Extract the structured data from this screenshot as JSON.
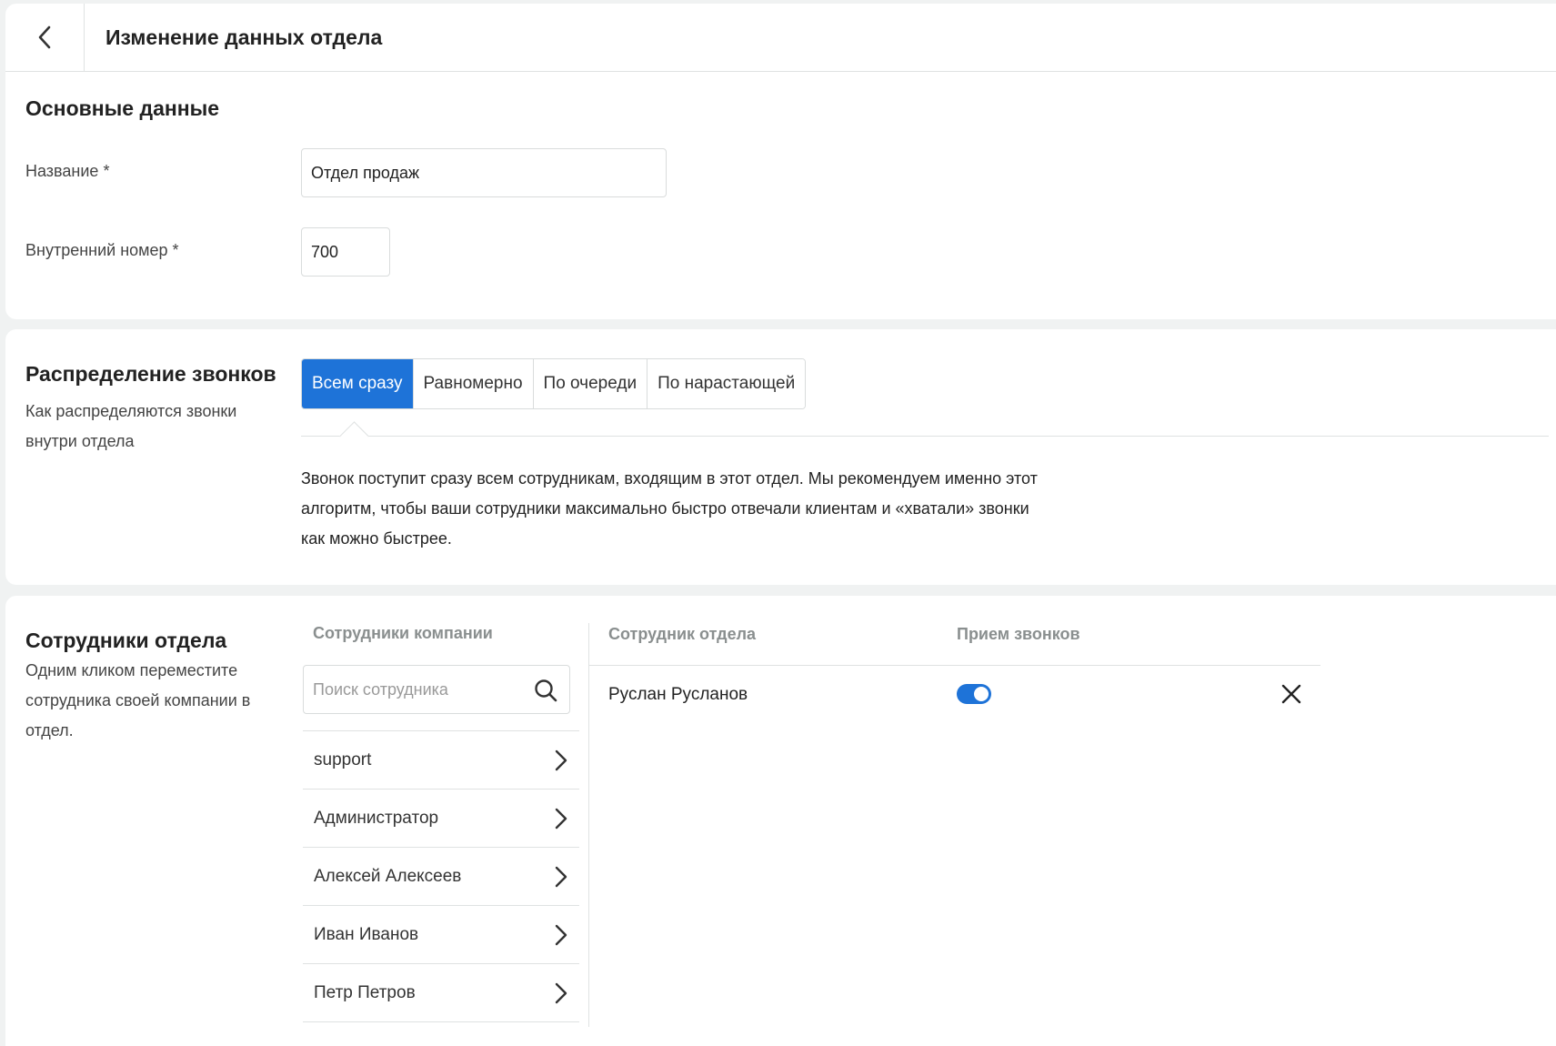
{
  "header": {
    "title": "Изменение данных отдела",
    "back_icon": "chevron-left-icon"
  },
  "basic": {
    "title": "Основные данные",
    "name_label": "Название *",
    "name_value": "Отдел продаж",
    "ext_label": "Внутренний номер *",
    "ext_value": "700"
  },
  "distribution": {
    "title": "Распределение звонков",
    "description": "Как распределяются звонки внутри отдела",
    "options": [
      "Всем сразу",
      "Равномерно",
      "По очереди",
      "По нарастающей"
    ],
    "selected": "Всем сразу",
    "explanation": "Звонок поступит сразу всем сотрудникам, входящим в этот отдел. Мы рекомендуем именно этот алгоритм, чтобы ваши сотрудники максимально быстро отвечали клиентам и «хватали» звонки как можно быстрее."
  },
  "staff": {
    "title": "Сотрудники отдела",
    "description": "Одним кликом переместите сотрудника своей компании в отдел.",
    "company_header": "Сотрудники компании",
    "search_placeholder": "Поиск сотрудника",
    "company_list": [
      "support",
      "Администратор",
      "Алексей Алексеев",
      "Иван Иванов",
      "Петр Петров"
    ],
    "dept_header": "Сотрудник отдела",
    "calls_header": "Прием звонков",
    "dept_members": [
      {
        "name": "Руслан Русланов",
        "receiving_calls": true
      }
    ]
  },
  "colors": {
    "accent": "#1e73d8",
    "background": "#f0f2f2"
  }
}
